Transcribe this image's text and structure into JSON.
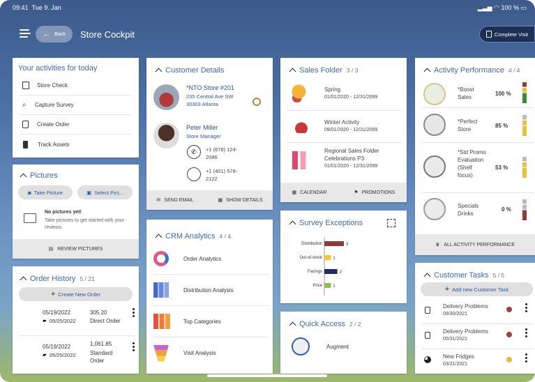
{
  "status": {
    "time": "09:41",
    "date": "Tue 9. Jan",
    "battery": "100 %"
  },
  "header": {
    "back": "Back",
    "title": "Store Cockpit",
    "complete": "Complete Visit"
  },
  "activities": {
    "title": "Your activities for today",
    "items": [
      "Store Check",
      "Capture Survey",
      "Create Order",
      "Track Assets"
    ]
  },
  "pictures": {
    "title": "Pictures",
    "take": "Take Picture",
    "select": "Select Pict...",
    "empty_title": "No pictures yet!",
    "empty_text": "Take pictures to get started with your reviews.",
    "review": "REVIEW PICTURES"
  },
  "orders": {
    "title": "Order History",
    "count": "5 / 21",
    "create": "Create New Order",
    "rows": [
      {
        "d1": "05/19/2022",
        "d2": "05/25/2022",
        "amount": "305.20",
        "type": "Direct Order"
      },
      {
        "d1": "05/19/2022",
        "d2": "05/25/2022",
        "amount": "1,061.85",
        "type": "Standard Order"
      }
    ]
  },
  "customer": {
    "title": "Customer Details",
    "store": "*NTO Store #201",
    "addr1": "235 Central Ave SW",
    "addr2": "30303 Atlanta",
    "person": "Peter Miller",
    "role": "Store Manager",
    "phone": "+1 (678) 124-2086",
    "mobile": "+1 (401) 578-2122",
    "send": "SEND EMAIL",
    "show": "SHOW DETAILS"
  },
  "crm": {
    "title": "CRM Analytics",
    "count": "4 / 4",
    "items": [
      "Order Analytics",
      "Distribution Analysis",
      "Top Categories",
      "Visit Analysis"
    ]
  },
  "sales": {
    "title": "Sales Folder",
    "count": "3 / 3",
    "items": [
      {
        "name": "Spring",
        "dates": "01/01/2020 - 12/31/2099"
      },
      {
        "name": "Winter Activity",
        "dates": "09/01/2020 - 12/31/2099"
      },
      {
        "name": "Regional Sales Folder Celebrations P3",
        "dates": "01/01/2020 - 12/31/2099"
      }
    ],
    "calendar": "CALENDAR",
    "promotions": "PROMOTIONS"
  },
  "survey": {
    "title": "Survey Exceptions"
  },
  "chart_data": {
    "type": "bar",
    "categories": [
      "Distribution",
      "Out-of-stock",
      "Facings",
      "Price"
    ],
    "values": [
      3,
      1,
      2,
      1
    ],
    "colors": [
      "#8b3a3a",
      "#f0c830",
      "#1f2e6b",
      "#8cc04a"
    ]
  },
  "quick": {
    "title": "Quick Access",
    "count": "2 / 2",
    "items": [
      "Augment"
    ]
  },
  "performance": {
    "title": "Activity Performance",
    "count": "4 / 4",
    "items": [
      {
        "name": "*Boost Sales",
        "pct": "100 %",
        "color": "#3a8a3a"
      },
      {
        "name": "*Perfect Store",
        "pct": "85 %",
        "color": "#e6c23c"
      },
      {
        "name": "*Std Promo Evaluation (Shelf focus)",
        "pct": "53 %",
        "color": "#e6c23c"
      },
      {
        "name": "Specials Drinks",
        "pct": "0 %",
        "color": "#8b3a3a"
      }
    ],
    "all": "ALL ACTIVITY PERFORMANCE"
  },
  "tasks": {
    "title": "Customer Tasks",
    "count": "5 / 5",
    "add": "Add new Customer Task",
    "items": [
      {
        "name": "Delivery Problems",
        "date": "09/30/2021",
        "color": "#a0403a"
      },
      {
        "name": "Delivery Problems",
        "date": "05/31/2021",
        "color": "#a0403a"
      },
      {
        "name": "New Fridges",
        "date": "03/31/2021",
        "color": "#e6b93a"
      }
    ]
  }
}
